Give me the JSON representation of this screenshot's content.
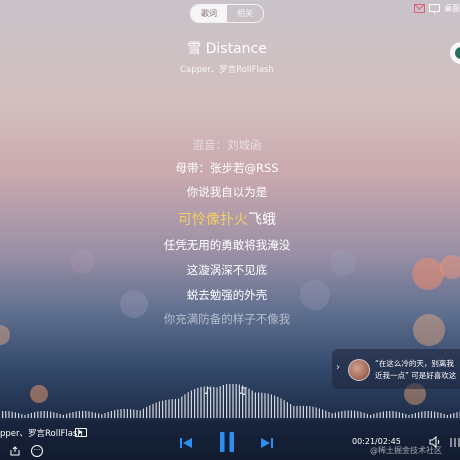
{
  "tabs": {
    "lyrics": "歌词",
    "related": "相关"
  },
  "window": {
    "desktop_label": "桌面"
  },
  "song": {
    "title": "雪 Distance",
    "artists": "Capper、罗言RollFlash"
  },
  "lyrics": {
    "mix": "混音：刘城函",
    "take": "母带：张步若@RSS",
    "l1": "你说我自以为是",
    "current_hl": "可怜像扑火",
    "current_rest": "飞蛾",
    "l3": "任凭无用的勇敢将我淹没",
    "l4": "这漩涡深不见底",
    "l5": "蜕去勉强的外壳",
    "l6": "你充满防备的样子不像我"
  },
  "comment": {
    "line1": "“在这么冷的天，别离我",
    "line2": "近我一点” 可是好喜欢这"
  },
  "now_playing": {
    "artists": "pper、罗言RollFlash"
  },
  "player": {
    "time": "00:21/02:45"
  },
  "watermark": "@稀土掘金技术社区",
  "colors": {
    "highlight": "#f3cf63"
  }
}
